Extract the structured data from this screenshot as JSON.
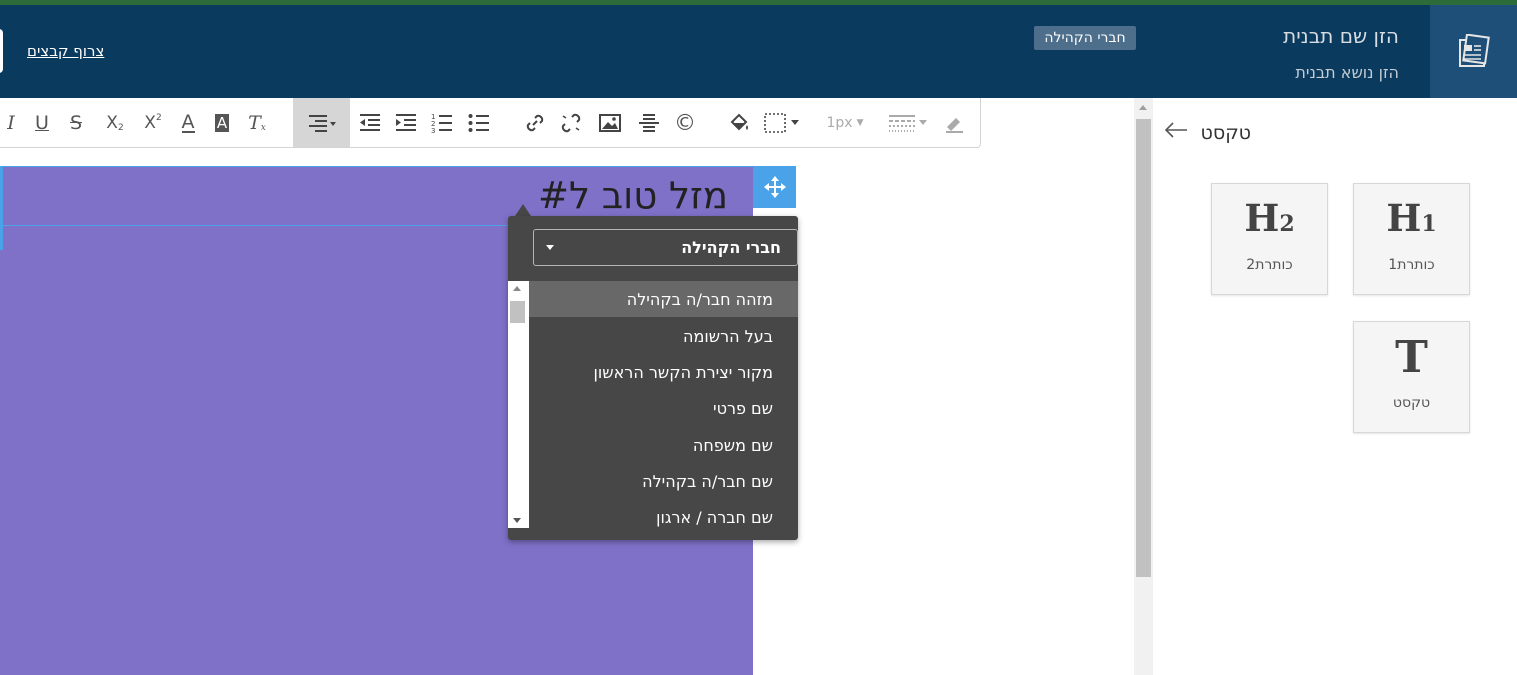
{
  "header": {
    "template_name_placeholder": "הזן שם תבנית",
    "template_subject_placeholder": "הזן נושא תבנית",
    "badge": "חברי הקהילה",
    "attach_files": "צרוף קבצים",
    "icon": "newsletter-icon"
  },
  "toolbar": {
    "items": [
      {
        "name": "italic-button",
        "glyph": "I"
      },
      {
        "name": "underline-button",
        "glyph": "U"
      },
      {
        "name": "strikethrough-button",
        "glyph": "S"
      },
      {
        "name": "subscript-button",
        "glyph": "X₂"
      },
      {
        "name": "superscript-button",
        "glyph": "X²"
      },
      {
        "name": "font-color-button",
        "glyph": "A"
      },
      {
        "name": "background-color-button",
        "glyph": "A"
      },
      {
        "name": "clear-format-button",
        "glyph": "Tx"
      },
      {
        "name": "align-button",
        "glyph": "align-icon"
      },
      {
        "name": "outdent-button",
        "glyph": "outdent-icon"
      },
      {
        "name": "indent-button",
        "glyph": "indent-icon"
      },
      {
        "name": "ordered-list-button",
        "glyph": "ordered-list-icon"
      },
      {
        "name": "bullet-list-button",
        "glyph": "bullet-list-icon"
      },
      {
        "name": "link-button",
        "glyph": "link-icon"
      },
      {
        "name": "unlink-button",
        "glyph": "unlink-icon"
      },
      {
        "name": "image-button",
        "glyph": "image-icon"
      },
      {
        "name": "horizontal-line-button",
        "glyph": "hr-icon"
      },
      {
        "name": "copyright-button",
        "glyph": "©"
      },
      {
        "name": "fill-color-button",
        "glyph": "paint-bucket-icon"
      },
      {
        "name": "border-button",
        "glyph": "border-icon"
      },
      {
        "name": "border-width-button",
        "glyph": "1px"
      },
      {
        "name": "border-style-button",
        "glyph": "border-style-icon"
      },
      {
        "name": "eraser-button",
        "glyph": "eraser-icon"
      }
    ],
    "border_width": "1px"
  },
  "editor": {
    "heading_text": "מזל טוב ל#",
    "background_color": "#7f70c8"
  },
  "dropdown": {
    "selected_group": "חברי הקהילה",
    "items": [
      "מזהה חבר/ה בקהילה",
      "בעל הרשומה",
      "מקור יצירת הקשר הראשון",
      "שם פרטי",
      "שם משפחה",
      "שם חבר/ה בקהילה",
      "שם חברה / ארגון"
    ],
    "highlighted_index": 0
  },
  "panel": {
    "title": "טקסט",
    "blocks": [
      {
        "glyph": "H",
        "sub": "1",
        "label": "כותרת1"
      },
      {
        "glyph": "H",
        "sub": "2",
        "label": "כותרת2"
      },
      {
        "glyph": "T",
        "sub": "",
        "label": "טקסט"
      }
    ]
  }
}
